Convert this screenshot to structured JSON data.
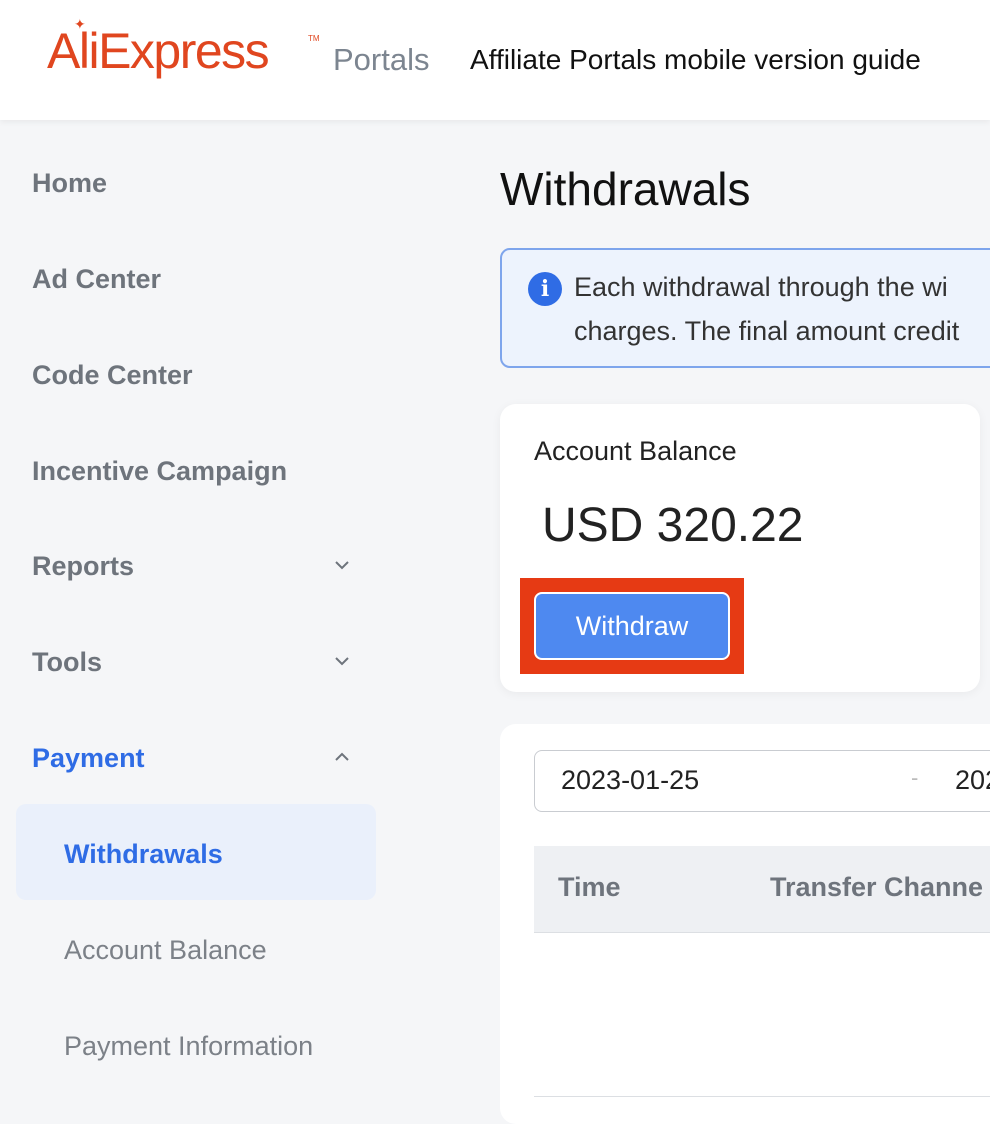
{
  "header": {
    "logo_text": "AliExpress",
    "logo_sub": "Portals",
    "guide_link": "Affiliate Portals mobile version guide"
  },
  "sidebar": {
    "items": [
      {
        "label": "Home"
      },
      {
        "label": "Ad Center"
      },
      {
        "label": "Code Center"
      },
      {
        "label": "Incentive Campaign"
      },
      {
        "label": "Reports",
        "expandable": true,
        "expanded": false
      },
      {
        "label": "Tools",
        "expandable": true,
        "expanded": false
      },
      {
        "label": "Payment",
        "expandable": true,
        "expanded": true
      }
    ],
    "payment_subitems": [
      {
        "label": "Withdrawals",
        "active": true
      },
      {
        "label": "Account Balance"
      },
      {
        "label": "Payment Information"
      }
    ]
  },
  "main": {
    "title": "Withdrawals",
    "notice": {
      "line1": "Each withdrawal through the wi",
      "line2": "charges. The final amount credit"
    },
    "balance": {
      "label": "Account Balance",
      "amount": "USD 320.22",
      "withdraw_label": "Withdraw"
    },
    "filter": {
      "start_date": "2023-01-25",
      "separator": "-",
      "end_date": "202"
    },
    "table": {
      "columns": [
        "Time",
        "Transfer Channe"
      ]
    }
  },
  "colors": {
    "brand": "#e0461f",
    "accent": "#2f6ce5",
    "button": "#4e89f0",
    "highlight": "#e63a14"
  }
}
